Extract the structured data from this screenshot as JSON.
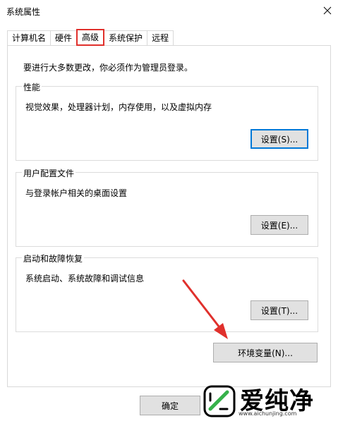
{
  "window": {
    "title": "系统属性"
  },
  "tabs": [
    {
      "label": "计算机名"
    },
    {
      "label": "硬件"
    },
    {
      "label": "高级"
    },
    {
      "label": "系统保护"
    },
    {
      "label": "远程"
    }
  ],
  "panel": {
    "intro": "要进行大多数更改，你必须作为管理员登录。",
    "performance": {
      "label": "性能",
      "description": "视觉效果，处理器计划，内存使用，以及虚拟内存",
      "button": "设置(S)..."
    },
    "user_profiles": {
      "label": "用户配置文件",
      "description": "与登录帐户相关的桌面设置",
      "button": "设置(E)..."
    },
    "startup_recovery": {
      "label": "启动和故障恢复",
      "description": "系统启动、系统故障和调试信息",
      "button": "设置(T)..."
    },
    "env_button": "环境变量(N)..."
  },
  "footer": {
    "ok_button": "确定"
  },
  "watermark": {
    "text": "爱纯净",
    "url": "www.aichunjing.com"
  },
  "colors": {
    "highlight_red": "#e0302c",
    "focus_blue": "#0078d7",
    "button_face": "#e1e1e1"
  }
}
